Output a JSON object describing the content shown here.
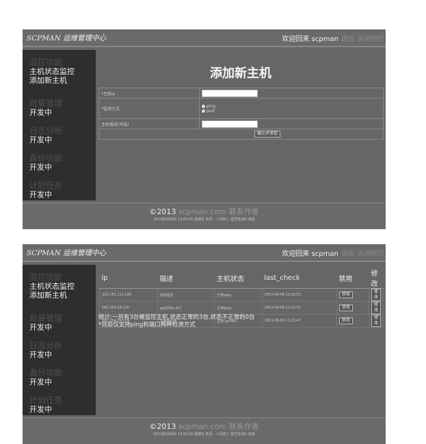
{
  "header": {
    "brand": "SCPMAN 运维管理中心",
    "welcome": "欢迎回来 scpman",
    "faint_links": "退出  关闭侧栏"
  },
  "sidebar": {
    "p1": [
      {
        "title": "监控功能",
        "items": [
          "主机状态监控",
          "添加新主机"
        ]
      },
      {
        "title": "批量管理",
        "items": [
          "开发中"
        ]
      },
      {
        "title": "日志分析",
        "items": [
          "开发中"
        ]
      },
      {
        "title": "备份功能",
        "items": [
          "开发中"
        ]
      },
      {
        "title": "计划任务",
        "items": [
          "开发中"
        ]
      }
    ],
    "p2": [
      {
        "title": "监控功能",
        "items": [
          "主机状态监控",
          "添加新主机"
        ]
      },
      {
        "title": "批量管理",
        "items": [
          "开发中"
        ]
      },
      {
        "title": "日志分析",
        "items": [
          "开发中"
        ]
      },
      {
        "title": "备份功能",
        "items": [
          "开发中"
        ]
      },
      {
        "title": "计划任务",
        "items": [
          "开发中"
        ]
      }
    ]
  },
  "add_form": {
    "title": "添加新主机",
    "ip_label": "*主机ip",
    "method_label": "*监测方式",
    "method_options": [
      "ping",
      "port"
    ],
    "desc_label": "主机描述(可选)",
    "submit": "确认并添加"
  },
  "host_table": {
    "headers": [
      "ip",
      "描述",
      "主机状态",
      "last_check",
      "禁用",
      "修改"
    ],
    "rows": [
      {
        "ip": "220.181.111.148",
        "desc": "百度首页",
        "status": "正常ping",
        "last_check": "2013-09-06 11:20:51",
        "disable": "禁用",
        "edit": "修改"
      },
      {
        "ip": "182.254.28.130",
        "desc": "qq空间ip 对了",
        "status": "正常ping",
        "last_check": "2013-09-06 11:21:33",
        "disable": "禁用",
        "edit": "修改"
      },
      {
        "ip": "182.254.18.159",
        "desc": "注释我的呀",
        "status": "正常-port80",
        "last_check": "2013-09-06 11:21:47",
        "disable": "禁用",
        "edit": "修改"
      }
    ],
    "summary_line1": "统计:一共有3台被监控主机,状态正常的3台,状态不正常的0台",
    "summary_line2": "*目前仅支持ping和端口两种检测方式"
  },
  "footer": {
    "copyright": "©2013",
    "site": "scpman.com 联系作者",
    "sub": "2013年9月6日 13:04:25 星期五 农历：八月初二 星巴克(如) 来说"
  }
}
